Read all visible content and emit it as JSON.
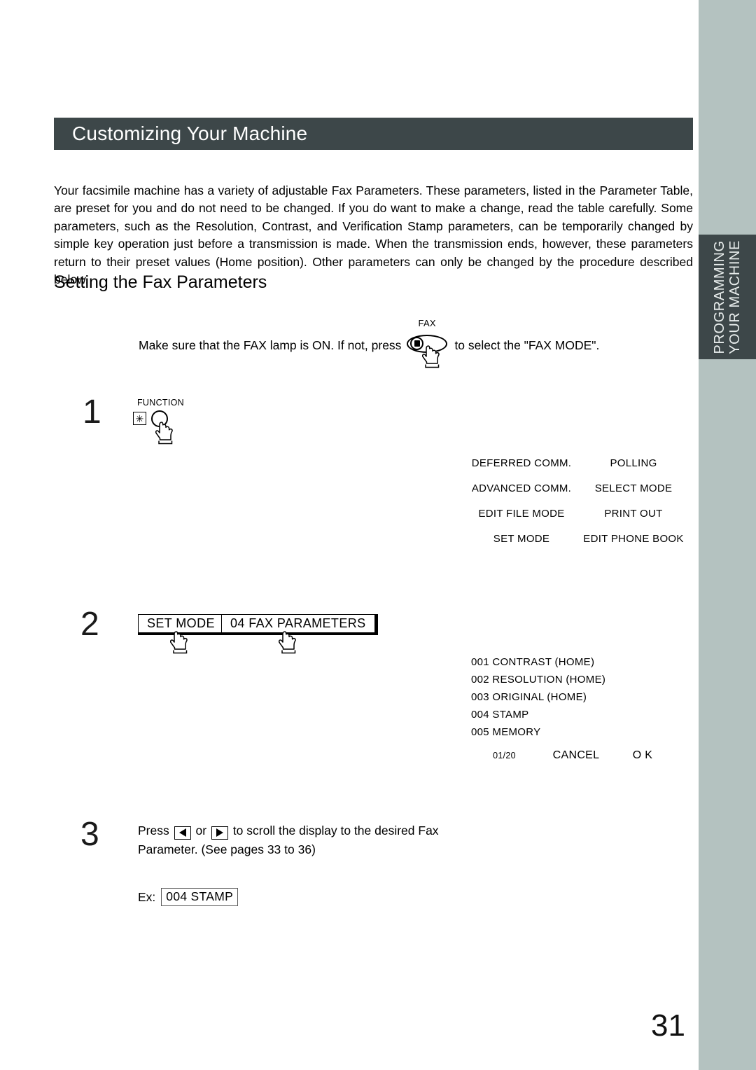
{
  "side_tab": {
    "line1": "PROGRAMMING",
    "line2": "YOUR MACHINE",
    "tab_color": "#3d4749",
    "strip_color": "#b4c2c0"
  },
  "header": {
    "title": "Customizing Your Machine",
    "bar_color": "#3d4749"
  },
  "intro": {
    "paragraph": "Your facsimile machine has a variety of adjustable Fax Parameters.  These parameters, listed in the Parameter Table, are preset for you and do not need to be changed.  If you do want to make a change, read the table carefully.  Some parameters, such as the Resolution, Contrast, and Verification Stamp parameters, can be temporarily changed by simple key operation just before a transmission is made.  When the transmission ends, however, these parameters return to their preset values (Home position).  Other parameters can only be changed by the procedure described below."
  },
  "subheading": "Setting the Fax Parameters",
  "fax_lamp": {
    "text_before": "Make sure that the FAX lamp is ON.  If not, press",
    "button_label": "FAX",
    "text_after": "to select the \"FAX MODE\"."
  },
  "steps": {
    "one": {
      "number": "1",
      "function_label": "FUNCTION",
      "star_glyph": "✳"
    },
    "two": {
      "number": "2",
      "key1": "SET MODE",
      "key2": "04 FAX PARAMETERS"
    },
    "three": {
      "number": "3",
      "line1_a": "Press",
      "line1_or": "or",
      "line1_b": "to scroll the display to the desired Fax",
      "line2": "Parameter. (See pages 33 to 36)",
      "ex_label": "Ex:",
      "ex_value": "004 STAMP"
    }
  },
  "lcd_menu": {
    "rows": [
      {
        "left": "DEFERRED COMM.",
        "right": "POLLING"
      },
      {
        "left": "ADVANCED COMM.",
        "right": "SELECT MODE"
      },
      {
        "left": "EDIT FILE MODE",
        "right": "PRINT OUT"
      },
      {
        "left": "SET MODE",
        "right": "EDIT PHONE BOOK"
      }
    ]
  },
  "lcd_params": {
    "items": [
      "001 CONTRAST (HOME)",
      "002 RESOLUTION (HOME)",
      "003 ORIGINAL (HOME)",
      "004 STAMP",
      "005 MEMORY"
    ],
    "page_indicator": "01/20",
    "cancel_label": "CANCEL",
    "ok_label": "O K"
  },
  "page_number": "31"
}
